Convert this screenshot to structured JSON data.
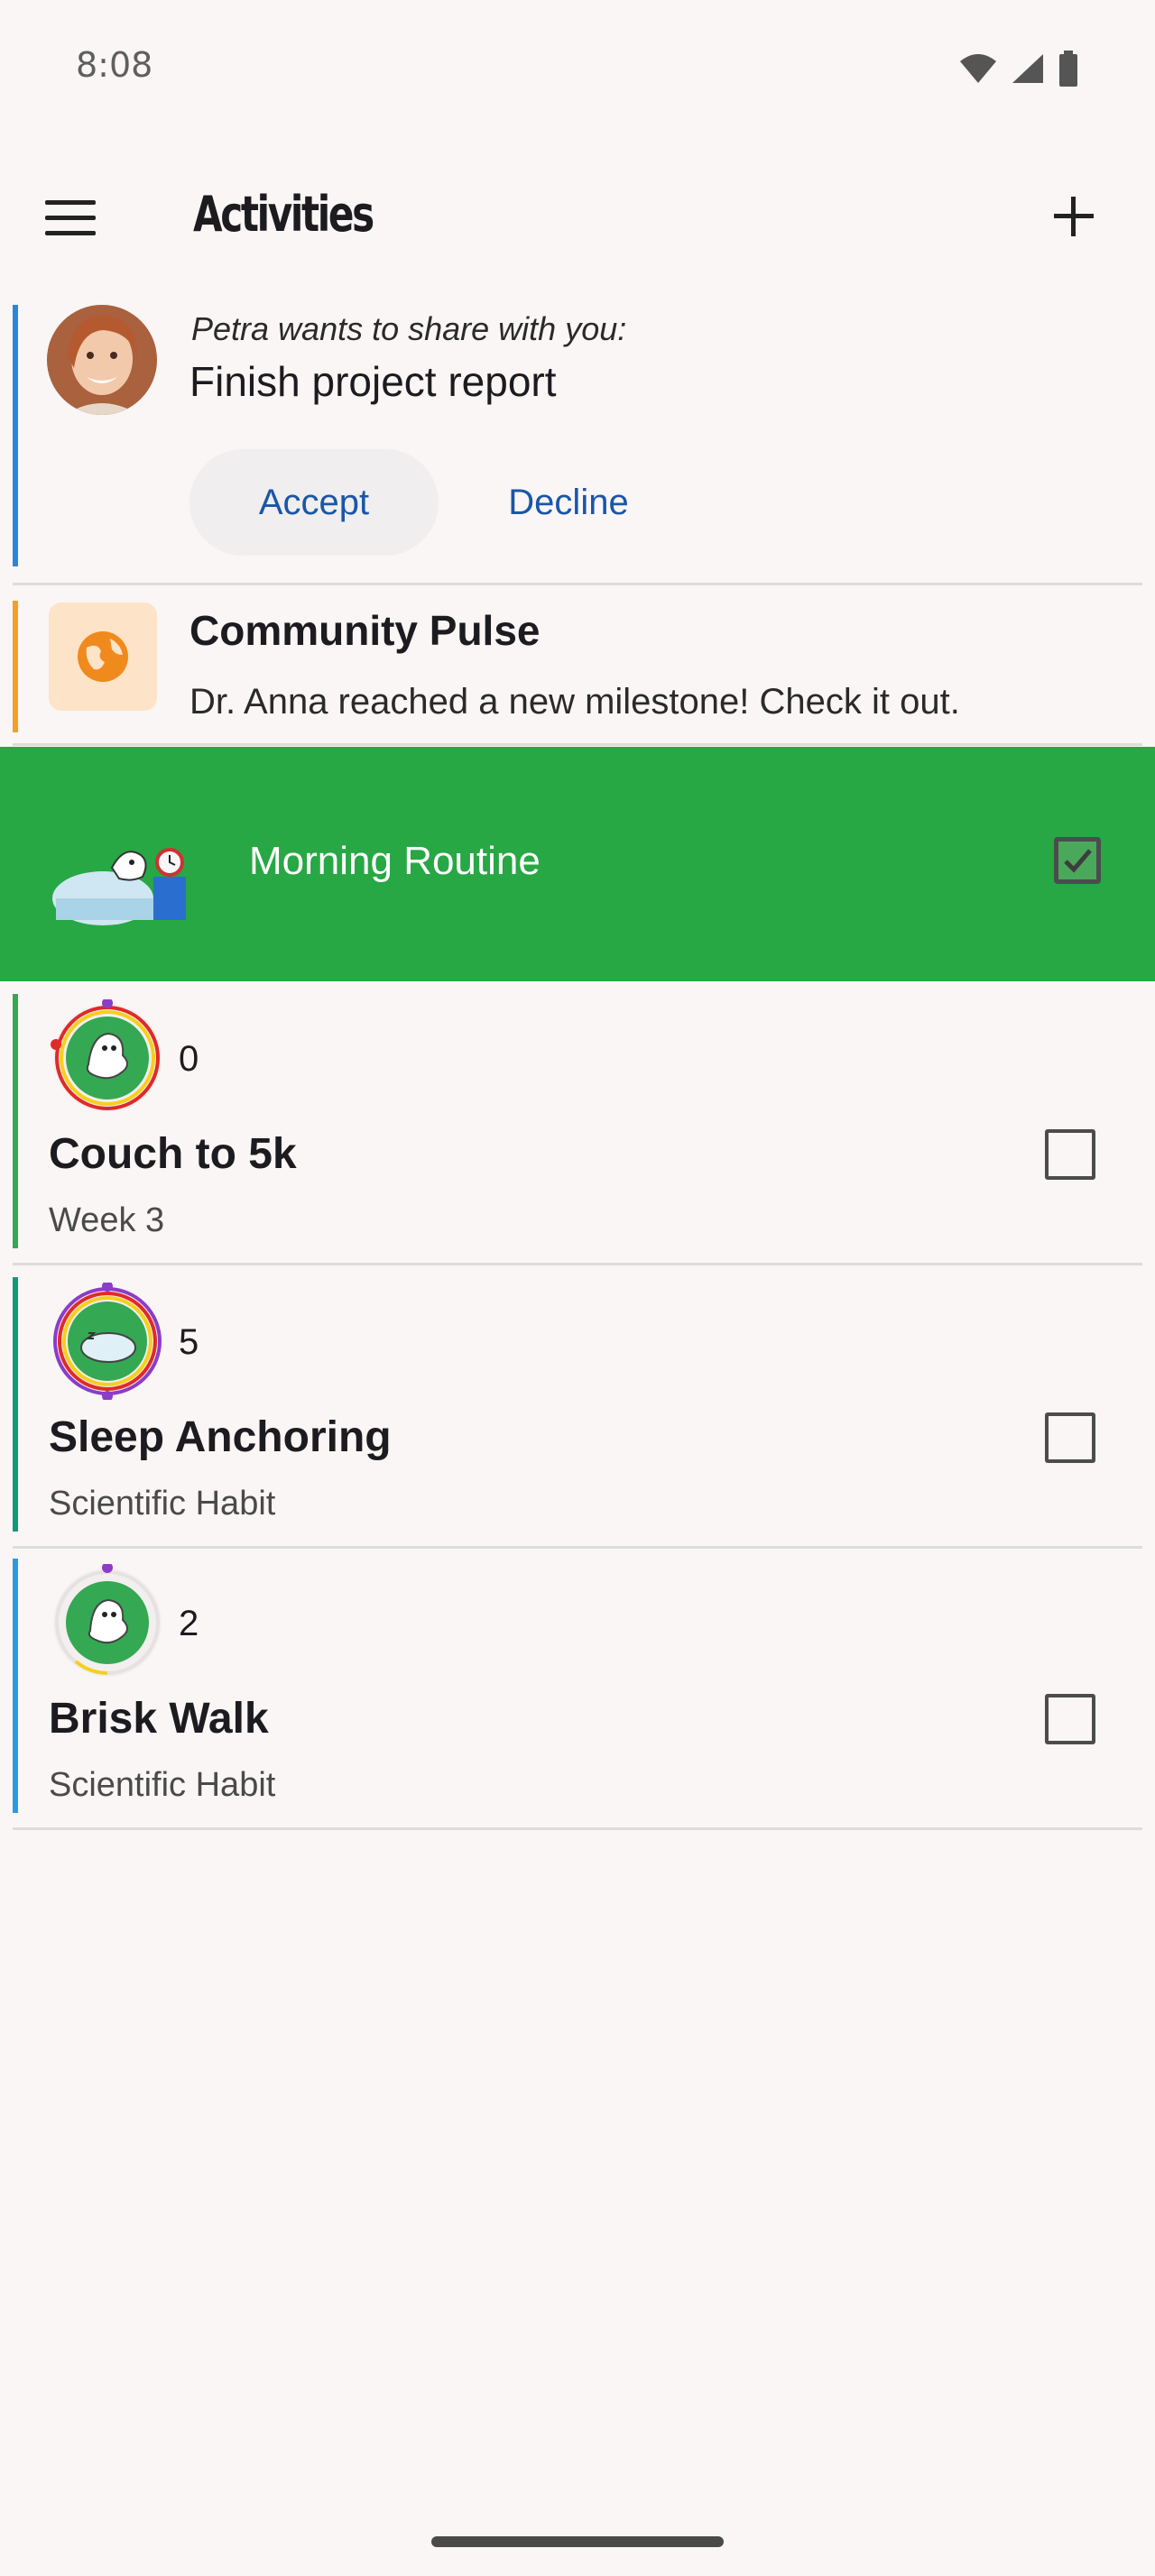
{
  "status": {
    "time": "8:08"
  },
  "app_bar": {
    "title": "Activities"
  },
  "share_request": {
    "invite_text": "Petra wants to share with you:",
    "item_title": "Finish project report",
    "accept_label": "Accept",
    "decline_label": "Decline"
  },
  "community": {
    "title": "Community Pulse",
    "body": "Dr. Anna reached a new milestone! Check it out."
  },
  "routine": {
    "title": "Morning Routine",
    "checked": true
  },
  "habits": [
    {
      "count": "0",
      "name": "Couch to 5k",
      "subtitle": "Week 3",
      "accent": "#34a853",
      "checked": false
    },
    {
      "count": "5",
      "name": "Sleep Anchoring",
      "subtitle": "Scientific Habit",
      "accent": "#0f9b7a",
      "checked": false
    },
    {
      "count": "2",
      "name": "Brisk Walk",
      "subtitle": "Scientific Habit",
      "accent": "#2b9be0",
      "checked": false
    }
  ],
  "colors": {
    "routine_bg": "#28a745",
    "link": "#1a56a8",
    "share_accent": "#2b86d9",
    "community_accent": "#f2a02a"
  }
}
